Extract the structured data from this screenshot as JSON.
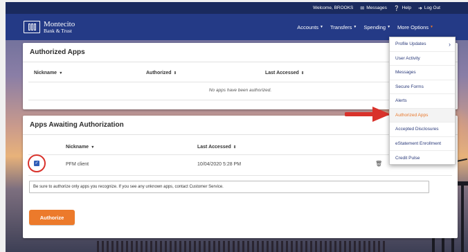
{
  "utility_bar": {
    "welcome": "Welcome, BROOKS",
    "messages": "Messages",
    "help": "Help",
    "logout": "Log Out"
  },
  "brand": {
    "line1": "Montecito",
    "line2": "Bank & Trust"
  },
  "nav": {
    "items": [
      {
        "label": "Accounts"
      },
      {
        "label": "Transfers"
      },
      {
        "label": "Spending"
      },
      {
        "label": "More Options"
      }
    ]
  },
  "authorized_apps": {
    "title": "Authorized Apps",
    "columns": {
      "nickname": "Nickname",
      "authorized": "Authorized",
      "last_accessed": "Last Accessed"
    },
    "empty_message": "No apps have been authorized."
  },
  "awaiting": {
    "title": "Apps Awaiting Authorization",
    "columns": {
      "nickname": "Nickname",
      "last_accessed": "Last Accessed"
    },
    "rows": [
      {
        "nickname": "PFM client",
        "last_accessed": "10/04/2020 5:28 PM",
        "checked": true
      }
    ],
    "notice": "Be sure to authorize only apps you recognize. If you see any unknown apps, contact Customer Service.",
    "authorize_label": "Authorize"
  },
  "dropdown": {
    "items": [
      {
        "label": "Profile Updates",
        "has_submenu": true
      },
      {
        "label": "User Activity"
      },
      {
        "label": "Messages"
      },
      {
        "label": "Secure Forms"
      },
      {
        "label": "Alerts"
      },
      {
        "label": "Authorized Apps",
        "active": true
      },
      {
        "label": "Accepted Disclosures"
      },
      {
        "label": "eStatement Enrollment"
      },
      {
        "label": "Credit Pulse"
      }
    ]
  },
  "colors": {
    "accent": "#ec7a2b",
    "header": "#243a86",
    "utility_bar": "#1a2a5e",
    "annotation": "#d9322b"
  },
  "icons": {
    "messages": "envelope-icon",
    "help": "question-circle-icon",
    "logout": "logout-arrow-icon",
    "row_delete": "trash-icon",
    "submenu": "chevron-right-icon"
  }
}
